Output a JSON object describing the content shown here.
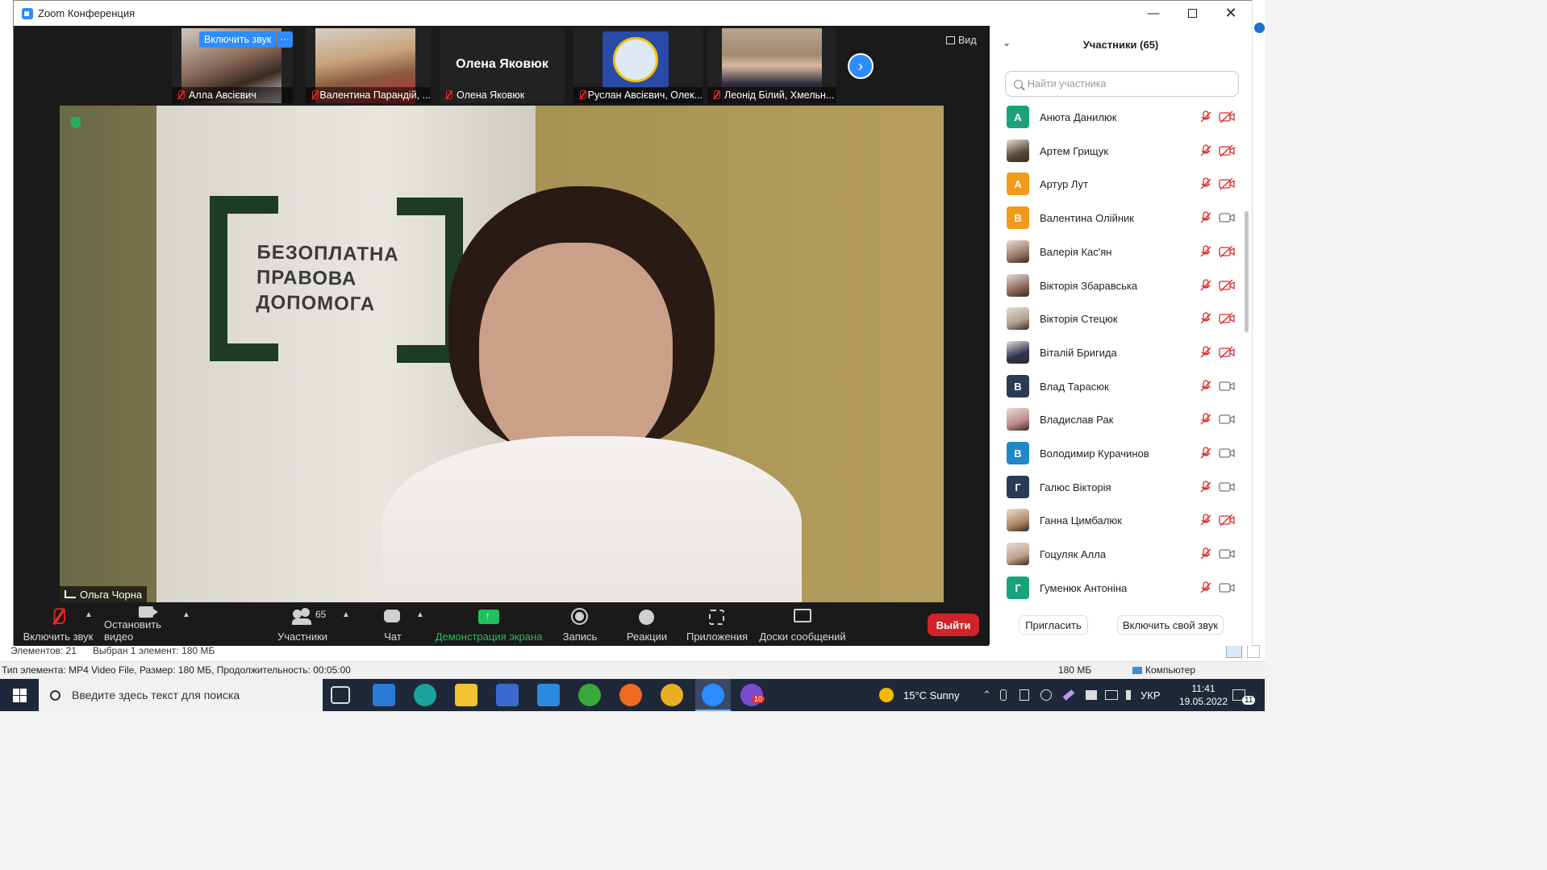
{
  "window": {
    "title": "Zoom Конференция"
  },
  "thumbnails": [
    {
      "name": "Алла Авсієвич",
      "unmute_label": "Включить звук",
      "more": "···"
    },
    {
      "name": "Валентина Парандій, ..."
    },
    {
      "name": "Олена Яковюк",
      "big_label": "Олена Яковюк"
    },
    {
      "name": "Руслан Авсієвич, Олек..."
    },
    {
      "name": "Леонід Білий, Хмельн..."
    }
  ],
  "view_label": "Вид",
  "main_video": {
    "speaker": "Ольга Чорна",
    "banner_lines": [
      "БЕЗОПЛАТНА",
      "ПРАВОВА",
      "ДОПОМОГА"
    ]
  },
  "toolbar": {
    "unmute": "Включить звук",
    "stop_video": "Остановить видео",
    "participants": "Участники",
    "participants_count": "65",
    "chat": "Чат",
    "share": "Демонстрация экрана",
    "record": "Запись",
    "reactions": "Реакции",
    "apps": "Приложения",
    "whiteboards": "Доски сообщений",
    "leave": "Выйти"
  },
  "panel": {
    "title": "Участники (65)",
    "search_placeholder": "Найти участника",
    "invite": "Пригласить",
    "unmute_self": "Включить свой звук",
    "participants": [
      {
        "name": "Анюта Данилюк",
        "initial": "А",
        "color": "#1aa37a",
        "photo": false,
        "cam": "off"
      },
      {
        "name": "Артем Грищук",
        "initial": "",
        "color": "#5a4a3a",
        "photo": true,
        "cam": "off"
      },
      {
        "name": "Артур Лут",
        "initial": "А",
        "color": "#f29a1c",
        "photo": false,
        "cam": "off"
      },
      {
        "name": "Валентина Олійник",
        "initial": "В",
        "color": "#f29a1c",
        "photo": false,
        "cam": "on"
      },
      {
        "name": "Валерія Кас'ян",
        "initial": "",
        "color": "#9a7a6a",
        "photo": true,
        "cam": "off"
      },
      {
        "name": "Вікторія Збаравська",
        "initial": "",
        "color": "#8a6a5a",
        "photo": true,
        "cam": "off"
      },
      {
        "name": "Вікторія Стецюк",
        "initial": "",
        "color": "#b0a090",
        "photo": true,
        "cam": "off"
      },
      {
        "name": "Віталій Бригида",
        "initial": "",
        "color": "#2a3550",
        "photo": true,
        "cam": "off"
      },
      {
        "name": "Влад Тарасюк",
        "initial": "В",
        "color": "#2b3a55",
        "photo": false,
        "cam": "on"
      },
      {
        "name": "Владислав Рак",
        "initial": "",
        "color": "#c08a8a",
        "photo": true,
        "cam": "on"
      },
      {
        "name": "Володимир Курачинов",
        "initial": "В",
        "color": "#1e88c8",
        "photo": false,
        "cam": "on"
      },
      {
        "name": "Галюс Вікторія",
        "initial": "Г",
        "color": "#2b3a55",
        "photo": false,
        "cam": "on"
      },
      {
        "name": "Ганна Цимбалюк",
        "initial": "",
        "color": "#b08a60",
        "photo": true,
        "cam": "off"
      },
      {
        "name": "Гоцуляк Алла",
        "initial": "",
        "color": "#c0a090",
        "photo": true,
        "cam": "on"
      },
      {
        "name": "Гуменюк Антоніна",
        "initial": "Г",
        "color": "#1aa37a",
        "photo": false,
        "cam": "on"
      }
    ]
  },
  "explorer": {
    "status_items": "Элементов: 21",
    "status_selected": "Выбран 1 элемент: 180 МБ",
    "details": "Тип элемента: MP4 Video File, Размер: 180 МБ, Продолжительность: 00:05:00",
    "size": "180 МБ",
    "location": "Компьютер"
  },
  "taskbar": {
    "search_placeholder": "Введите здесь текст для поиска",
    "weather": "15°C  Sunny",
    "lang": "УКР",
    "time": "11:41",
    "date": "19.05.2022",
    "notifications": "11",
    "viber_badge": "10"
  }
}
